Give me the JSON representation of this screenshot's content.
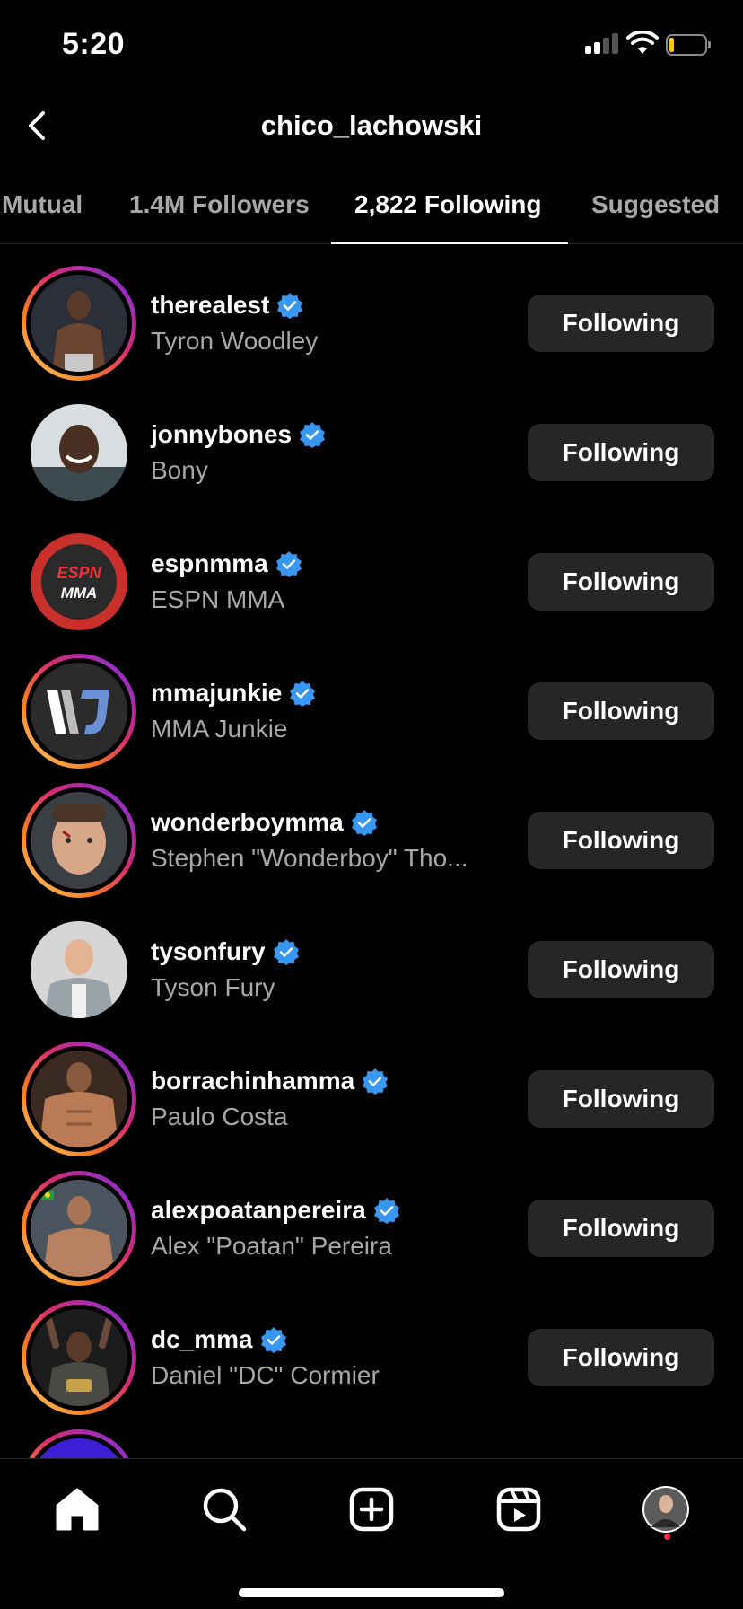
{
  "status_bar": {
    "time": "5:20",
    "battery_color": "#f5c518"
  },
  "header": {
    "title": "chico_lachowski",
    "back_icon": "chevron-left-icon"
  },
  "tabs": [
    {
      "label": "Mutual",
      "active": false
    },
    {
      "label": "1.4M Followers",
      "active": false
    },
    {
      "label": "2,822 Following",
      "active": true
    },
    {
      "label": "Suggested",
      "active": false
    }
  ],
  "following": [
    {
      "username": "therealest",
      "name": "Tyron Woodley",
      "verified": true,
      "story": true,
      "button": "Following"
    },
    {
      "username": "jonnybones",
      "name": "Bony",
      "verified": true,
      "story": false,
      "button": "Following"
    },
    {
      "username": "espnmma",
      "name": "ESPN MMA",
      "verified": true,
      "story": false,
      "button": "Following",
      "logo_text": [
        "ESPN",
        "MMA"
      ]
    },
    {
      "username": "mmajunkie",
      "name": "MMA Junkie",
      "verified": true,
      "story": true,
      "button": "Following"
    },
    {
      "username": "wonderboymma",
      "name": "Stephen \"Wonderboy\" Tho...",
      "verified": true,
      "story": true,
      "button": "Following"
    },
    {
      "username": "tysonfury",
      "name": "Tyson Fury",
      "verified": true,
      "story": false,
      "button": "Following"
    },
    {
      "username": "borrachinhamma",
      "name": "Paulo Costa",
      "verified": true,
      "story": true,
      "button": "Following"
    },
    {
      "username": "alexpoatanpereira",
      "name": "Alex \"Poatan\" Pereira",
      "verified": true,
      "story": true,
      "button": "Following"
    },
    {
      "username": "dc_mma",
      "name": "Daniel \"DC\" Cormier",
      "verified": true,
      "story": true,
      "button": "Following"
    }
  ],
  "bottom_nav": [
    {
      "name": "home-icon"
    },
    {
      "name": "search-icon"
    },
    {
      "name": "create-post-icon"
    },
    {
      "name": "reels-icon"
    },
    {
      "name": "profile-avatar-icon"
    }
  ],
  "colors": {
    "background": "#000000",
    "secondary_text": "#a8a8a8",
    "button_bg": "#262626",
    "verified_blue": "#3897f0",
    "notification_dot": "#ff3040"
  }
}
